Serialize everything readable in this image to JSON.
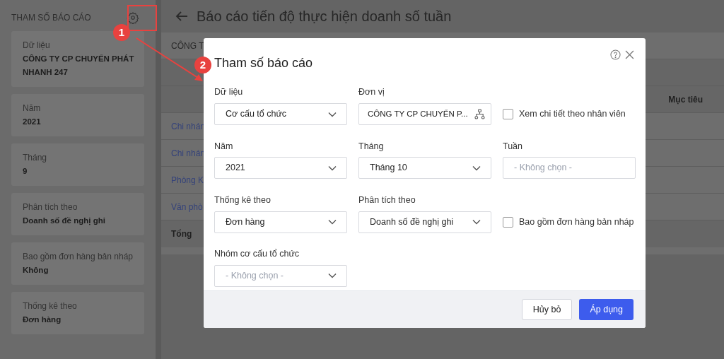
{
  "sidebar": {
    "title": "THAM SỐ BÁO CÁO",
    "cards": [
      {
        "label": "Dữ liệu",
        "value": "CÔNG TY CP CHUYỂN PHÁT NHANH 247"
      },
      {
        "label": "Năm",
        "value": "2021"
      },
      {
        "label": "Tháng",
        "value": "9"
      },
      {
        "label": "Phân tích theo",
        "value": "Doanh số đề nghị ghi"
      },
      {
        "label": "Bao gồm đơn hàng bản nháp",
        "value": "Không"
      },
      {
        "label": "Thống kê theo",
        "value": "Đơn hàng"
      }
    ]
  },
  "page": {
    "title": "Báo cáo tiến độ thực hiện doanh số tuần",
    "table": {
      "company": "CÔNG T",
      "column_header": "Mục tiêu",
      "rows": [
        "Chi nhán",
        "Chi nhán",
        "Phòng K",
        "Văn phò"
      ],
      "total": "Tổng"
    }
  },
  "dialog": {
    "title": "Tham số báo cáo",
    "fields": [
      {
        "kind": "select",
        "label": "Dữ liệu",
        "value": "Cơ cấu tổ chức"
      },
      {
        "kind": "picker",
        "label": "Đơn vị",
        "value": "CÔNG TY CP CHUYỂN P..."
      },
      {
        "kind": "checkbox",
        "text": "Xem chi tiết theo nhân viên",
        "checked": false
      },
      {
        "kind": "select",
        "label": "Năm",
        "value": "2021"
      },
      {
        "kind": "select",
        "label": "Tháng",
        "value": "Tháng 10"
      },
      {
        "kind": "input",
        "label": "Tuần",
        "placeholder": "- Không chọn -"
      },
      {
        "kind": "select",
        "label": "Thống kê theo",
        "value": "Đơn hàng"
      },
      {
        "kind": "select",
        "label": "Phân tích theo",
        "value": "Doanh số đề nghị ghi"
      },
      {
        "kind": "checkbox",
        "text": "Bao gồm đơn hàng bản nháp",
        "checked": false
      },
      {
        "kind": "select",
        "label": "Nhóm cơ cấu tổ chức",
        "placeholder": "- Không chọn -"
      }
    ],
    "buttons": [
      {
        "label": "Hủy bỏ",
        "primary": false
      },
      {
        "label": "Áp dụng",
        "primary": true
      }
    ]
  },
  "annotations": [
    {
      "label": "1"
    },
    {
      "label": "2"
    }
  ]
}
